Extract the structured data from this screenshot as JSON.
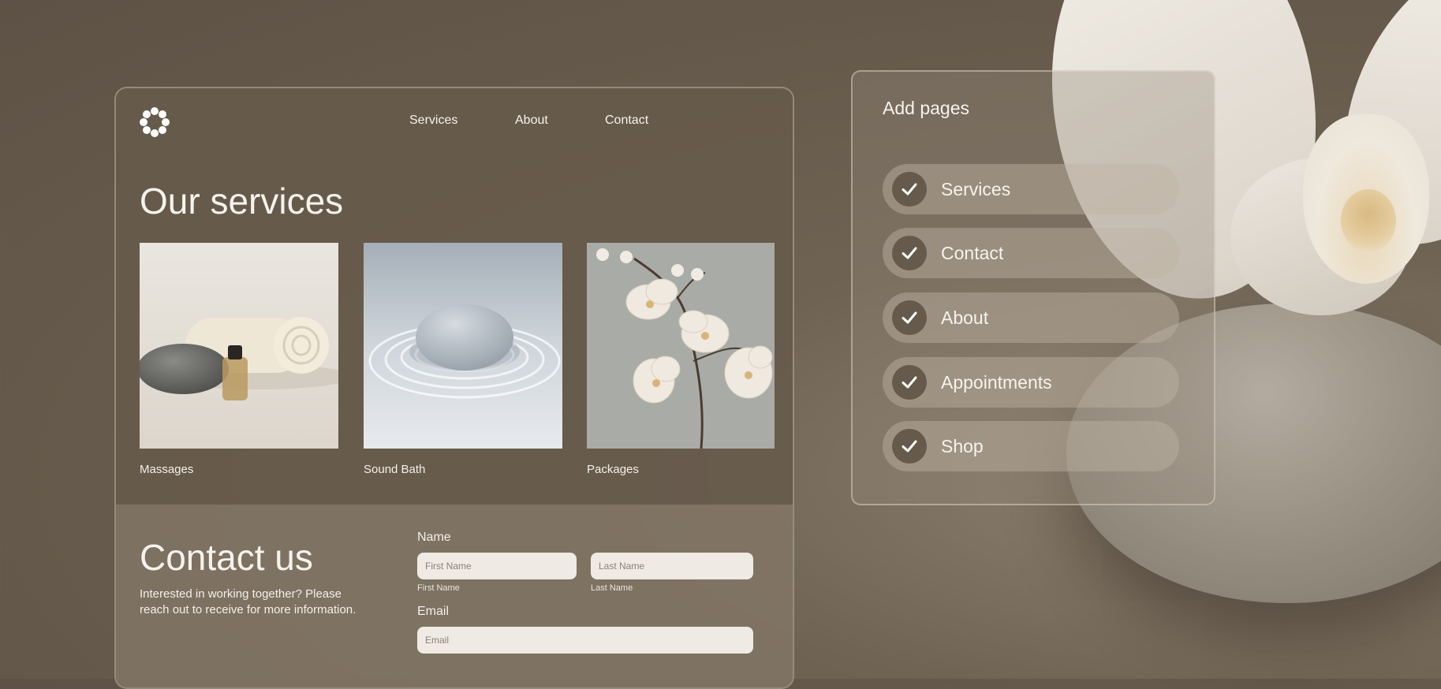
{
  "site": {
    "nav": [
      "Services",
      "About",
      "Contact"
    ],
    "title": "Our services",
    "services": [
      {
        "label": "Massages",
        "icon": "spa-stones-towel-image"
      },
      {
        "label": "Sound Bath",
        "icon": "zen-stone-sand-image"
      },
      {
        "label": "Packages",
        "icon": "orchid-flowers-image"
      }
    ]
  },
  "contact": {
    "title": "Contact us",
    "description": "Interested in working together? Please reach out to receive for more information.",
    "name_label": "Name",
    "first_name_placeholder": "First Name",
    "first_name_caption": "First Name",
    "last_name_placeholder": "Last Name",
    "last_name_caption": "Last Name",
    "email_label": "Email",
    "email_placeholder": "Email"
  },
  "pages_panel": {
    "title": "Add pages",
    "items": [
      {
        "label": "Services",
        "checked": true
      },
      {
        "label": "Contact",
        "checked": true
      },
      {
        "label": "About",
        "checked": true
      },
      {
        "label": "Appointments",
        "checked": true
      },
      {
        "label": "Shop",
        "checked": true
      }
    ]
  },
  "colors": {
    "background": "#6b5f50",
    "input_fill": "#efeae4",
    "check_circle": "#5f5446"
  }
}
